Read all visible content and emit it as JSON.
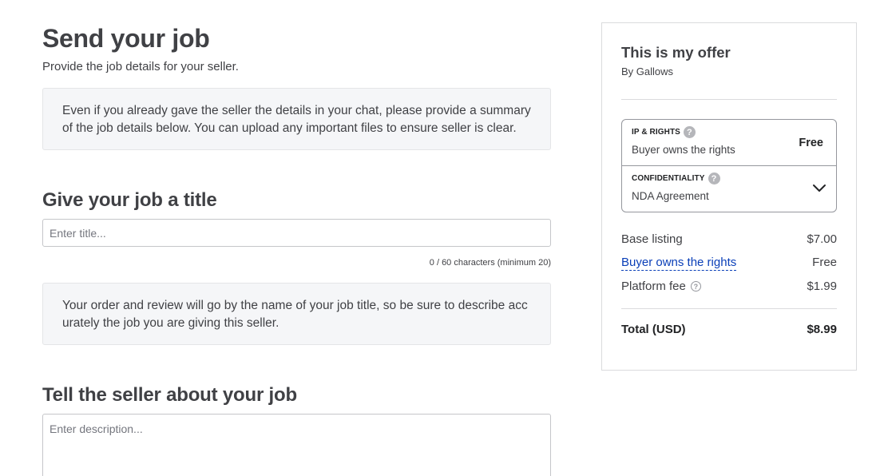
{
  "main": {
    "title": "Send your job",
    "subtitle": "Provide the job details for your seller.",
    "intro_note": "Even if you already gave the seller the details in your chat, please provide a summary of the job details below. You can upload any important files to ensure seller is clear.",
    "title_section": {
      "heading": "Give your job a title",
      "placeholder": "Enter title...",
      "value": "",
      "char_count": "0 / 60 characters (minimum 20)",
      "note": "Your order and review will go by the name of your job title, so be sure to describe acc urately the job you are giving this seller."
    },
    "description_section": {
      "heading": "Tell the seller about your job",
      "placeholder": "Enter description...",
      "value": ""
    }
  },
  "offer": {
    "title": "This is my offer",
    "by": "By Gallows",
    "ip_rights": {
      "label": "IP & RIGHTS",
      "value": "Buyer owns the rights",
      "price": "Free",
      "help_icon": "question-circle-icon"
    },
    "confidentiality": {
      "label": "CONFIDENTIALITY",
      "value": "NDA Agreement",
      "help_icon": "question-circle-icon",
      "dropdown_icon": "chevron-down-icon"
    },
    "breakdown": [
      {
        "label": "Base listing",
        "value": "$7.00"
      },
      {
        "label": "Buyer owns the rights",
        "value": "Free"
      },
      {
        "label": "Platform fee",
        "value": "$1.99"
      }
    ],
    "total": {
      "label": "Total (USD)",
      "value": "$8.99"
    }
  },
  "colors": {
    "text": "#404145",
    "link": "#0a3fb8",
    "note_bg": "#f5f6f8",
    "border": "#dadbdd"
  }
}
